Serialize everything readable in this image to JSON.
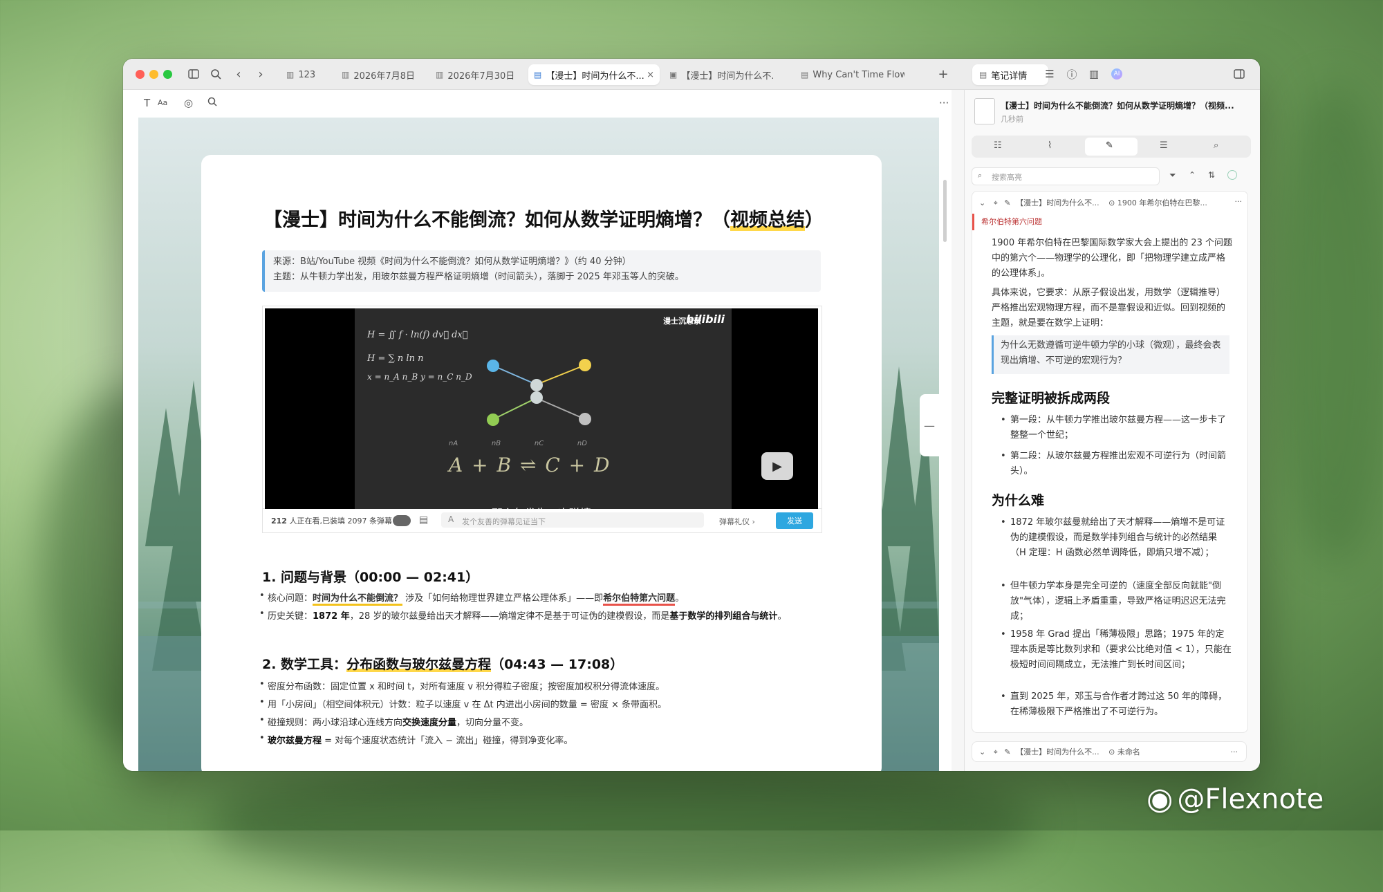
{
  "window": {
    "tabs": [
      {
        "icon": "book-icon",
        "label": "123"
      },
      {
        "icon": "book-icon",
        "label": "2026年7月8日"
      },
      {
        "icon": "book-icon",
        "label": "2026年7月30日"
      },
      {
        "icon": "doc-icon",
        "label": "【漫士】时间为什么不...",
        "active": true
      },
      {
        "icon": "video-icon",
        "label": "【漫士】时间为什么不..."
      },
      {
        "icon": "doc-icon",
        "label": "Why Can't Time Flow ..."
      }
    ],
    "add_tab": "+",
    "right_panel_tab": "笔记详情",
    "ai_badge": "AI"
  },
  "editor": {
    "toolbar": {
      "text_icon": "T",
      "font_size": "Aa",
      "more": "···"
    },
    "title_main": "【漫士】时间为什么不能倒流？如何从数学证明熵增？（",
    "title_highlight": "视频总结",
    "title_end": "）",
    "quote_line1": "来源：B站/YouTube 视频《时间为什么不能倒流？如何从数学证明熵增？》（约 40 分钟）",
    "quote_line2": "主题：从牛顿力学出发，用玻尔兹曼方程严格证明熵增（时间箭头），落脚于 2025 年邓玉等人的突破。",
    "video": {
      "brand": "漫士沉思录",
      "logo": "bilibili",
      "formula1": "H = ∬ f · ln(f) dv⃗ dx⃗",
      "formula2": "H = ∑ n ln n",
      "formula3": "x = n_A n_B   y = n_C n_D",
      "reaction_labels": [
        "nA",
        "nB",
        "nC",
        "nD"
      ],
      "reaction": "A + B ⇌ C + D",
      "subtitle": "那么每发生一次碰撞",
      "viewer_count": "212",
      "status_text": " 人正在看,已装填 2097 条弹幕",
      "danmaku_placeholder": "发个友善的弹幕见证当下",
      "etiquette": "弹幕礼仪 ›",
      "send": "发送"
    },
    "section1": {
      "title": "1. 问题与背景（00:00 — 02:41）",
      "b1_prefix": "核心问题：",
      "b1_hl": "时间为什么不能倒流？",
      "b1_mid": " 涉及「如何给物理世界建立严格公理体系」——即",
      "b1_red": "希尔伯特第六问题",
      "b1_end": "。",
      "b2_prefix": "历史关键：",
      "b2_bold1": "1872 年",
      "b2_mid": "，28 岁的玻尔兹曼给出天才解释——熵增定律不是基于可证伪的建模假设，而是",
      "b2_bold2": "基于数学的排列组合与统计",
      "b2_end": "。"
    },
    "section2": {
      "title_prefix": "2. 数学工具：",
      "title_hl": "分布函数与玻尔兹曼方程",
      "title_suffix": "（04:43 — 17:08）",
      "b1": "密度分布函数：固定位置 x 和时间 t，对所有速度 v 积分得粒子密度；按密度加权积分得流体速度。",
      "b2": "用「小房间」（相空间体积元）计数：粒子以速度 v 在 Δt 内进出小房间的数量 = 密度 × 条带面积。",
      "b3_prefix": "碰撞规则：两小球沿球心连线方向",
      "b3_bold": "交换速度分量",
      "b3_end": "，切向分量不变。",
      "b4_bold": "玻尔兹曼方程",
      "b4_end": " = 对每个速度状态统计「流入 − 流出」碰撞，得到净变化率。"
    }
  },
  "sidebar": {
    "note_title": "【漫士】时间为什么不能倒流？如何从数学证明熵增？（视频...",
    "note_time": "几秒前",
    "search_placeholder": "搜索高亮",
    "card": {
      "source": "【漫士】时间为什么不...",
      "target": "1900 年希尔伯特在巴黎...",
      "tag": "希尔伯特第六问题",
      "p1": "1900 年希尔伯特在巴黎国际数学家大会上提出的 23 个问题中的第六个——物理学的公理化，即「把物理学建立成严格的公理体系」。",
      "p2": "具体来说，它要求：从原子假设出发，用数学（逻辑推导）严格推出宏观物理方程，而不是靠假设和近似。回到视频的主题，就是要在数学上证明：",
      "quote": "为什么无数遵循可逆牛顿力学的小球（微观），最终会表现出熵增、不可逆的宏观行为？",
      "h1": "完整证明被拆成两段",
      "h1_b1": "第一段：从牛顿力学推出玻尔兹曼方程——这一步卡了整整一个世纪；",
      "h1_b2": "第二段：从玻尔兹曼方程推出宏观不可逆行为（时间箭头）。",
      "h2": "为什么难",
      "h2_b1": "1872 年玻尔兹曼就给出了天才解释——熵增不是可证伪的建模假设，而是数学排列组合与统计的必然结果（H 定理：H 函数必然单调降低，即熵只增不减）；",
      "h2_b2": "但牛顿力学本身是完全可逆的（速度全部反向就能\"倒放\"气体），逻辑上矛盾重重，导致严格证明迟迟无法完成；",
      "h2_b3": "1958 年 Grad 提出「稀薄极限」思路；1975 年的定理本质是等比数列求和（要求公比绝对值 < 1），只能在极短时间间隔成立，无法推广到长时间区间；",
      "h2_b4": "直到 2025 年，邓玉与合作者才跨过这 50 年的障碍，在稀薄极限下严格推出了不可逆行为。"
    },
    "footer_source": "【漫士】时间为什么不...",
    "footer_target": "未命名"
  },
  "watermark": "@Flexnote"
}
